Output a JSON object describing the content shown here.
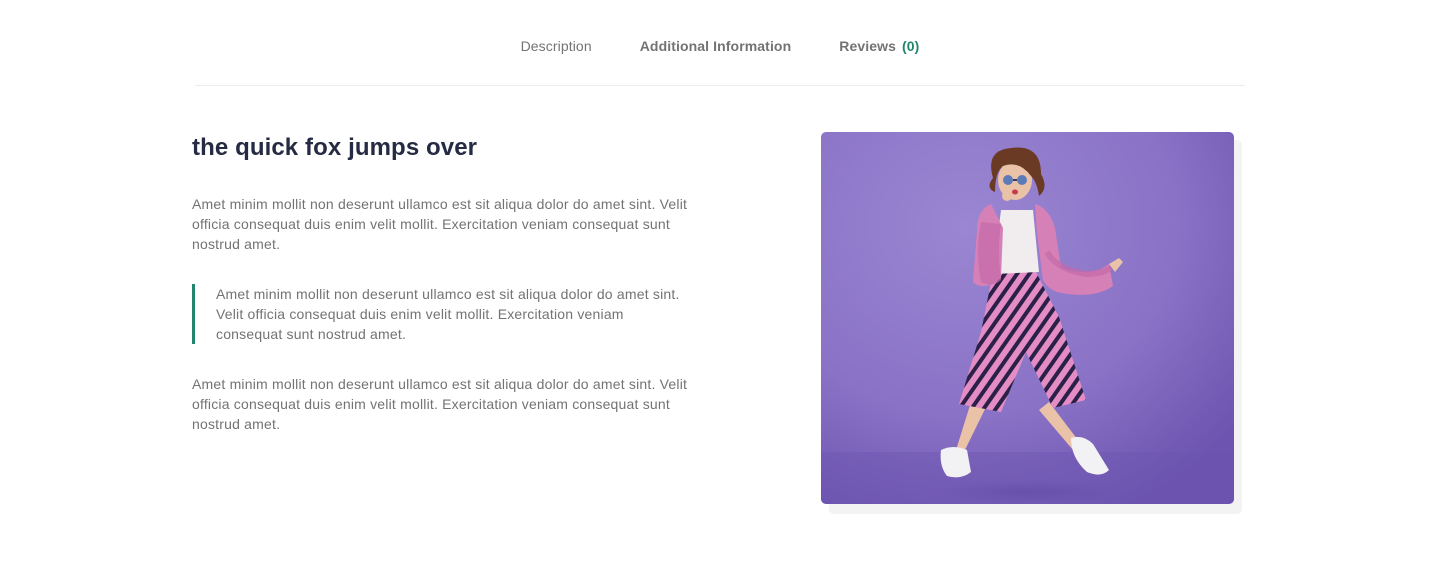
{
  "tabs": [
    {
      "label": "Description"
    },
    {
      "label": "Additional Information"
    },
    {
      "label": "Reviews",
      "count": "(0)"
    }
  ],
  "colors": {
    "accent": "#23856d",
    "heading": "#252b42",
    "body_text": "#737373",
    "image_bg": "#8a74c8"
  },
  "content": {
    "heading": "the quick fox jumps over",
    "paragraph_1": "Amet minim mollit non deserunt ullamco est sit aliqua dolor do amet sint. Velit officia consequat duis enim velit mollit. Exercitation veniam consequat sunt nostrud amet.",
    "quote": "Amet minim mollit non deserunt ullamco est sit aliqua dolor do amet sint. Velit officia consequat duis enim velit mollit. Exercitation veniam consequat sunt nostrud amet.",
    "paragraph_2": "Amet minim mollit non deserunt ullamco est sit aliqua dolor do amet sint. Velit officia consequat duis enim velit mollit. Exercitation veniam consequat sunt nostrud amet."
  },
  "image": {
    "icon": "fashion-photo"
  }
}
